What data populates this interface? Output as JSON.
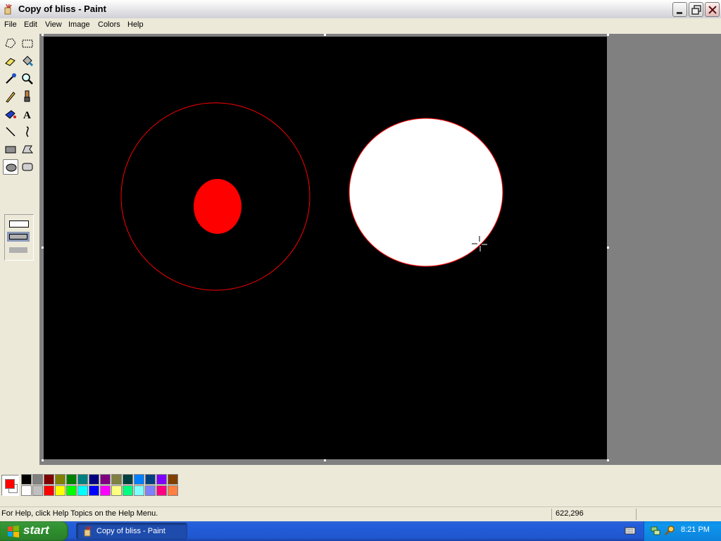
{
  "window": {
    "title": "Copy of bliss - Paint"
  },
  "menu": [
    "File",
    "Edit",
    "View",
    "Image",
    "Colors",
    "Help"
  ],
  "toolbox": {
    "tools": [
      "free-form-select",
      "select",
      "eraser",
      "fill-with-color",
      "pick-color",
      "magnifier",
      "pencil",
      "brush",
      "airbrush",
      "text",
      "line",
      "curve",
      "rectangle",
      "polygon",
      "ellipse",
      "rounded-rectangle"
    ],
    "selected_tool": "ellipse"
  },
  "canvas": {
    "background": "#000000",
    "shapes": [
      {
        "type": "ellipse-outline",
        "color": "#ff0000"
      },
      {
        "type": "ellipse-filled",
        "color": "#ff0000"
      },
      {
        "type": "ellipse-filled",
        "color": "#ffffff",
        "outline": "#ff0000"
      }
    ]
  },
  "palette": {
    "foreground": "#ff0000",
    "background": "#ffffff",
    "top_row": [
      "#000000",
      "#808080",
      "#800000",
      "#808000",
      "#008000",
      "#008080",
      "#000080",
      "#800080",
      "#808040",
      "#004040",
      "#0080ff",
      "#004080",
      "#8000ff",
      "#804000"
    ],
    "bottom_row": [
      "#ffffff",
      "#c0c0c0",
      "#ff0000",
      "#ffff00",
      "#00ff00",
      "#00ffff",
      "#0000ff",
      "#ff00ff",
      "#ffff80",
      "#00ff80",
      "#80ffff",
      "#8080ff",
      "#ff0080",
      "#ff8040"
    ]
  },
  "status": {
    "help_text": "For Help, click Help Topics on the Help Menu.",
    "coordinates": "622,296"
  },
  "taskbar": {
    "start_label": "start",
    "task_label": "Copy of bliss - Paint",
    "clock": "8:21 PM"
  }
}
